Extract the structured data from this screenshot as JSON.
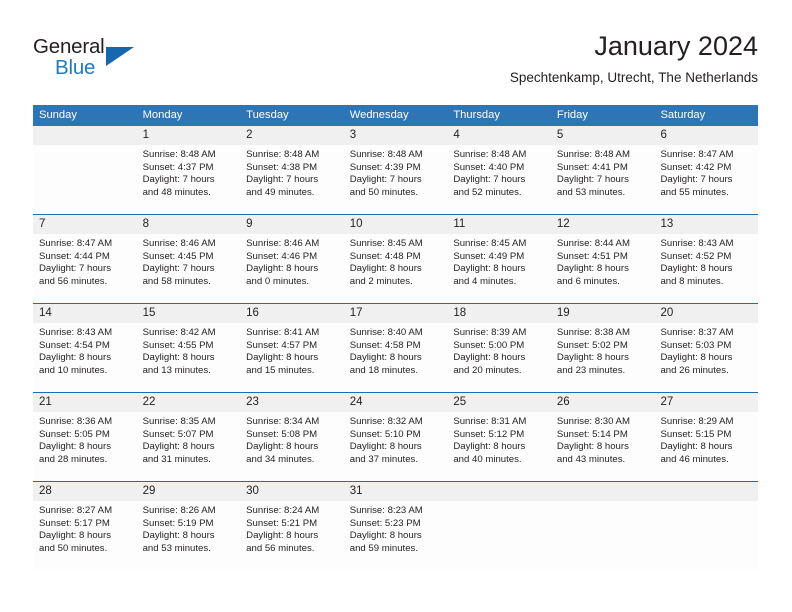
{
  "logo": {
    "text_primary": "General",
    "text_secondary": "Blue",
    "triangle_color": "#1668ad",
    "blue_color": "#1e7bc4"
  },
  "header": {
    "title": "January 2024",
    "subtitle": "Spechtenkamp, Utrecht, The Netherlands"
  },
  "theme": {
    "header_blue": "#2e75b6",
    "separator_blue": "#1f6cb0",
    "daynum_band": "#f0f0f0",
    "text": "#231f20"
  },
  "weekdays": [
    "Sunday",
    "Monday",
    "Tuesday",
    "Wednesday",
    "Thursday",
    "Friday",
    "Saturday"
  ],
  "weeks": [
    {
      "days": [
        {
          "num": "",
          "lines": [
            "",
            "",
            "",
            ""
          ]
        },
        {
          "num": "1",
          "lines": [
            "Sunrise: 8:48 AM",
            "Sunset: 4:37 PM",
            "Daylight: 7 hours",
            "and 48 minutes."
          ]
        },
        {
          "num": "2",
          "lines": [
            "Sunrise: 8:48 AM",
            "Sunset: 4:38 PM",
            "Daylight: 7 hours",
            "and 49 minutes."
          ]
        },
        {
          "num": "3",
          "lines": [
            "Sunrise: 8:48 AM",
            "Sunset: 4:39 PM",
            "Daylight: 7 hours",
            "and 50 minutes."
          ]
        },
        {
          "num": "4",
          "lines": [
            "Sunrise: 8:48 AM",
            "Sunset: 4:40 PM",
            "Daylight: 7 hours",
            "and 52 minutes."
          ]
        },
        {
          "num": "5",
          "lines": [
            "Sunrise: 8:48 AM",
            "Sunset: 4:41 PM",
            "Daylight: 7 hours",
            "and 53 minutes."
          ]
        },
        {
          "num": "6",
          "lines": [
            "Sunrise: 8:47 AM",
            "Sunset: 4:42 PM",
            "Daylight: 7 hours",
            "and 55 minutes."
          ]
        }
      ]
    },
    {
      "days": [
        {
          "num": "7",
          "lines": [
            "Sunrise: 8:47 AM",
            "Sunset: 4:44 PM",
            "Daylight: 7 hours",
            "and 56 minutes."
          ]
        },
        {
          "num": "8",
          "lines": [
            "Sunrise: 8:46 AM",
            "Sunset: 4:45 PM",
            "Daylight: 7 hours",
            "and 58 minutes."
          ]
        },
        {
          "num": "9",
          "lines": [
            "Sunrise: 8:46 AM",
            "Sunset: 4:46 PM",
            "Daylight: 8 hours",
            "and 0 minutes."
          ]
        },
        {
          "num": "10",
          "lines": [
            "Sunrise: 8:45 AM",
            "Sunset: 4:48 PM",
            "Daylight: 8 hours",
            "and 2 minutes."
          ]
        },
        {
          "num": "11",
          "lines": [
            "Sunrise: 8:45 AM",
            "Sunset: 4:49 PM",
            "Daylight: 8 hours",
            "and 4 minutes."
          ]
        },
        {
          "num": "12",
          "lines": [
            "Sunrise: 8:44 AM",
            "Sunset: 4:51 PM",
            "Daylight: 8 hours",
            "and 6 minutes."
          ]
        },
        {
          "num": "13",
          "lines": [
            "Sunrise: 8:43 AM",
            "Sunset: 4:52 PM",
            "Daylight: 8 hours",
            "and 8 minutes."
          ]
        }
      ]
    },
    {
      "days": [
        {
          "num": "14",
          "lines": [
            "Sunrise: 8:43 AM",
            "Sunset: 4:54 PM",
            "Daylight: 8 hours",
            "and 10 minutes."
          ]
        },
        {
          "num": "15",
          "lines": [
            "Sunrise: 8:42 AM",
            "Sunset: 4:55 PM",
            "Daylight: 8 hours",
            "and 13 minutes."
          ]
        },
        {
          "num": "16",
          "lines": [
            "Sunrise: 8:41 AM",
            "Sunset: 4:57 PM",
            "Daylight: 8 hours",
            "and 15 minutes."
          ]
        },
        {
          "num": "17",
          "lines": [
            "Sunrise: 8:40 AM",
            "Sunset: 4:58 PM",
            "Daylight: 8 hours",
            "and 18 minutes."
          ]
        },
        {
          "num": "18",
          "lines": [
            "Sunrise: 8:39 AM",
            "Sunset: 5:00 PM",
            "Daylight: 8 hours",
            "and 20 minutes."
          ]
        },
        {
          "num": "19",
          "lines": [
            "Sunrise: 8:38 AM",
            "Sunset: 5:02 PM",
            "Daylight: 8 hours",
            "and 23 minutes."
          ]
        },
        {
          "num": "20",
          "lines": [
            "Sunrise: 8:37 AM",
            "Sunset: 5:03 PM",
            "Daylight: 8 hours",
            "and 26 minutes."
          ]
        }
      ]
    },
    {
      "days": [
        {
          "num": "21",
          "lines": [
            "Sunrise: 8:36 AM",
            "Sunset: 5:05 PM",
            "Daylight: 8 hours",
            "and 28 minutes."
          ]
        },
        {
          "num": "22",
          "lines": [
            "Sunrise: 8:35 AM",
            "Sunset: 5:07 PM",
            "Daylight: 8 hours",
            "and 31 minutes."
          ]
        },
        {
          "num": "23",
          "lines": [
            "Sunrise: 8:34 AM",
            "Sunset: 5:08 PM",
            "Daylight: 8 hours",
            "and 34 minutes."
          ]
        },
        {
          "num": "24",
          "lines": [
            "Sunrise: 8:32 AM",
            "Sunset: 5:10 PM",
            "Daylight: 8 hours",
            "and 37 minutes."
          ]
        },
        {
          "num": "25",
          "lines": [
            "Sunrise: 8:31 AM",
            "Sunset: 5:12 PM",
            "Daylight: 8 hours",
            "and 40 minutes."
          ]
        },
        {
          "num": "26",
          "lines": [
            "Sunrise: 8:30 AM",
            "Sunset: 5:14 PM",
            "Daylight: 8 hours",
            "and 43 minutes."
          ]
        },
        {
          "num": "27",
          "lines": [
            "Sunrise: 8:29 AM",
            "Sunset: 5:15 PM",
            "Daylight: 8 hours",
            "and 46 minutes."
          ]
        }
      ]
    },
    {
      "days": [
        {
          "num": "28",
          "lines": [
            "Sunrise: 8:27 AM",
            "Sunset: 5:17 PM",
            "Daylight: 8 hours",
            "and 50 minutes."
          ]
        },
        {
          "num": "29",
          "lines": [
            "Sunrise: 8:26 AM",
            "Sunset: 5:19 PM",
            "Daylight: 8 hours",
            "and 53 minutes."
          ]
        },
        {
          "num": "30",
          "lines": [
            "Sunrise: 8:24 AM",
            "Sunset: 5:21 PM",
            "Daylight: 8 hours",
            "and 56 minutes."
          ]
        },
        {
          "num": "31",
          "lines": [
            "Sunrise: 8:23 AM",
            "Sunset: 5:23 PM",
            "Daylight: 8 hours",
            "and 59 minutes."
          ]
        },
        {
          "num": "",
          "lines": [
            "",
            "",
            "",
            ""
          ]
        },
        {
          "num": "",
          "lines": [
            "",
            "",
            "",
            ""
          ]
        },
        {
          "num": "",
          "lines": [
            "",
            "",
            "",
            ""
          ]
        }
      ]
    }
  ]
}
